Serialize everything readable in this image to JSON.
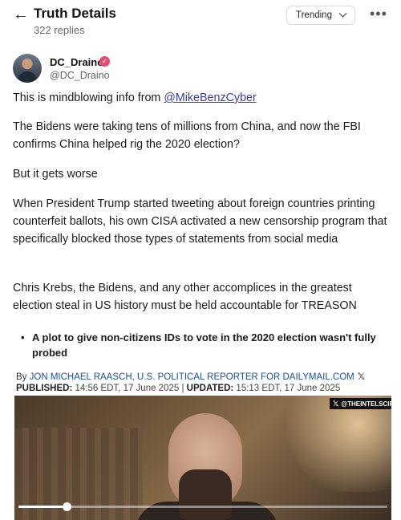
{
  "header": {
    "title": "Truth Details",
    "subtitle": "322 replies",
    "sort_label": "Trending"
  },
  "author": {
    "name": "DC_Draino",
    "handle": "@DC_Draino",
    "verified": true
  },
  "post": {
    "para1_prefix": "This is mindblowing info from ",
    "para1_mention": "@MikeBenzCyber",
    "para2": "The Bidens were taking tens of millions from China, and now the FBI confirms China helped rig the 2020 election?",
    "para3": "But it gets worse",
    "para4": "When President Trump started tweeting about foreign countries printing counterfeit ballots, his own CISA activated a new censorship program that specifically blocked those types of statements from social media",
    "para5": "Chris Krebs, the Bidens, and any other accomplices in the greatest election steal in US history must be held accountable for TREASON"
  },
  "article": {
    "bullet": "A plot to give non-citizens IDs to vote in the 2020 election wasn't fully probed",
    "byline_prefix": "By ",
    "byline_link": "JON MICHAEL RAASCH, U.S. POLITICAL REPORTER FOR DAILYMAIL.COM",
    "published_label": "PUBLISHED:",
    "published_value": " 14:56 EDT, 17 June 2025",
    "separator": " | ",
    "updated_label": "UPDATED:",
    "updated_value": " 15:13 EDT, 17 June 2025"
  },
  "video": {
    "watermark": "@THEINTELSCIF",
    "progress": 0.13
  }
}
